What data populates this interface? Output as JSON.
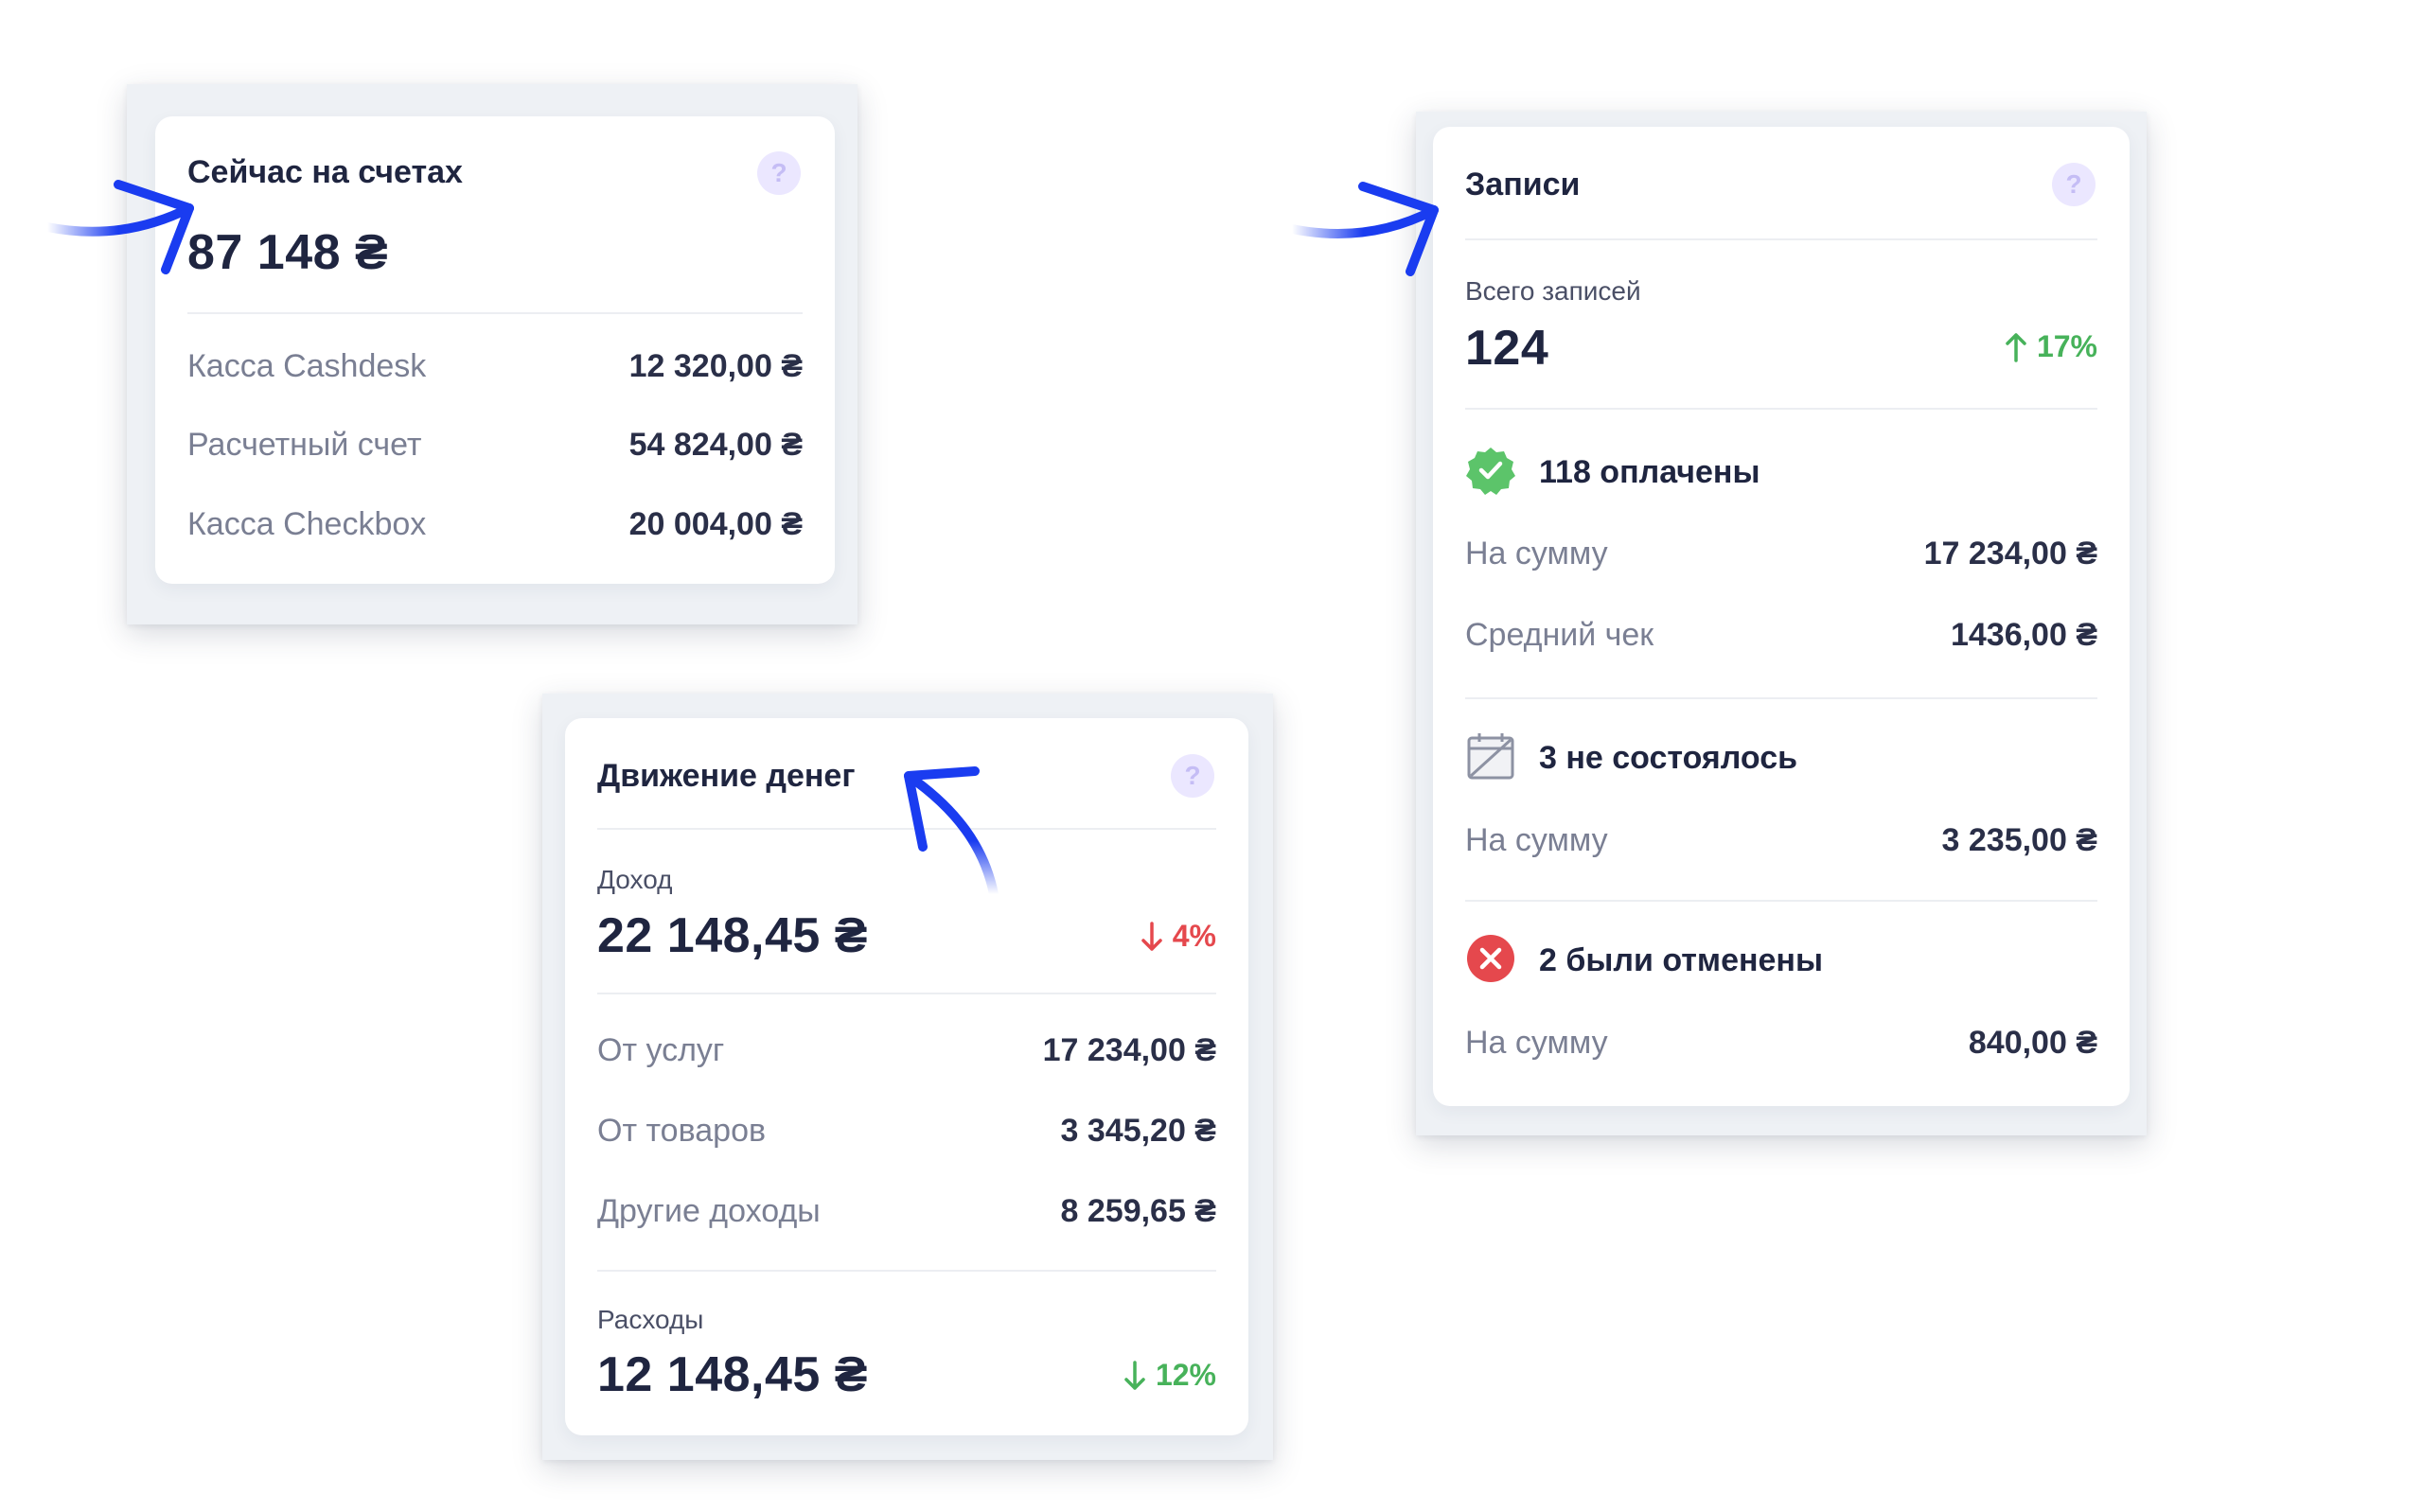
{
  "accounts": {
    "title": "Сейчас на счетах",
    "help_icon": "?",
    "total": "87 148 ₴",
    "rows": [
      {
        "label": "Касса Cashdesk",
        "value": "12 320,00 ₴"
      },
      {
        "label": "Расчетный счет",
        "value": "54 824,00 ₴"
      },
      {
        "label": "Касса Checkbox",
        "value": "20 004,00 ₴"
      }
    ]
  },
  "cashflow": {
    "title": "Движение денег",
    "help_icon": "?",
    "income_label": "Доход",
    "income_value": "22 148,45 ₴",
    "income_delta": "4%",
    "income_delta_color": "#e5484d",
    "rows": [
      {
        "label": "От услуг",
        "value": "17 234,00 ₴"
      },
      {
        "label": "От товаров",
        "value": "3 345,20 ₴"
      },
      {
        "label": "Другие доходы",
        "value": "8 259,65 ₴"
      }
    ],
    "expense_label": "Расходы",
    "expense_value": "12 148,45 ₴",
    "expense_delta": "12%",
    "expense_delta_color": "#47b25a"
  },
  "records": {
    "title": "Записи",
    "help_icon": "?",
    "total_label": "Всего записей",
    "total_value": "124",
    "total_delta": "17%",
    "total_delta_color": "#47b25a",
    "paid": {
      "icon": "verified-badge-icon",
      "text": "118 оплачены",
      "sum_label": "На сумму",
      "sum_value": "17 234,00 ₴",
      "avg_label": "Средний чек",
      "avg_value": "1436,00 ₴"
    },
    "missed": {
      "icon": "calendar-crossed-icon",
      "text": "3 не состоялось",
      "sum_label": "На сумму",
      "sum_value": "3 235,00 ₴"
    },
    "cancelled": {
      "icon": "cancel-circle-icon",
      "text": "2 были отменены",
      "sum_label": "На сумму",
      "sum_value": "840,00 ₴"
    }
  },
  "colors": {
    "accent_arrow": "#1a3cf0",
    "help_icon_bg": "#ebe7ff",
    "paid_green": "#5cc46a",
    "cancel_red": "#e5484d"
  }
}
